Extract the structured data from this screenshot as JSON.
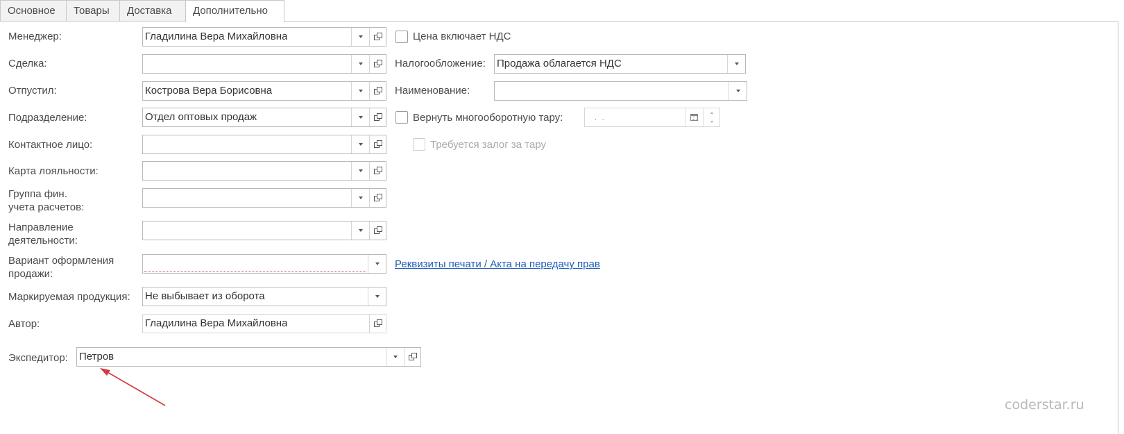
{
  "tabs": [
    {
      "label": "Основное"
    },
    {
      "label": "Товары"
    },
    {
      "label": "Доставка"
    },
    {
      "label": "Дополнительно"
    }
  ],
  "left": {
    "manager": {
      "label": "Менеджер:",
      "value": "Гладилина Вера Михайловна"
    },
    "deal": {
      "label": "Сделка:",
      "value": ""
    },
    "released": {
      "label": "Отпустил:",
      "value": "Кострова Вера Борисовна"
    },
    "division": {
      "label": "Подразделение:",
      "value": "Отдел оптовых продаж"
    },
    "contact": {
      "label": "Контактное лицо:",
      "value": ""
    },
    "loyalty": {
      "label": "Карта лояльности:",
      "value": ""
    },
    "fin_group": {
      "label_1": "Группа фин.",
      "label_2": "учета расчетов:",
      "value": ""
    },
    "direction": {
      "label_1": "Направление",
      "label_2": "деятельности:",
      "value": ""
    },
    "sale_variant": {
      "label_1": "Вариант оформления",
      "label_2": "продажи:",
      "value": ""
    },
    "marked": {
      "label": "Маркируемая продукция:",
      "value": "Не выбывает из оборота"
    },
    "author": {
      "label": "Автор:",
      "value": "Гладилина Вера Михайловна"
    },
    "expeditor": {
      "label": "Экспедитор:",
      "value": "Петров"
    }
  },
  "right": {
    "price_vat": {
      "label": "Цена включает НДС",
      "checked": false
    },
    "taxation": {
      "label": "Налогообложение:",
      "value": "Продажа облагается НДС"
    },
    "name": {
      "label": "Наименование:",
      "value": ""
    },
    "return_tare": {
      "label": "Вернуть многооборотную тару:",
      "checked": false,
      "date_value": " .  ."
    },
    "deposit": {
      "label": "Требуется залог за тару",
      "checked": false
    },
    "print_link": "Реквизиты печати / Акта на передачу прав"
  },
  "watermark": "coderstar.ru",
  "icons": {
    "dropdown": "chevron-down-icon",
    "open": "open-form-icon",
    "calendar": "calendar-icon"
  },
  "colors": {
    "link": "#1c5bb6",
    "arrow": "#d43a3a",
    "border": "#b9b9b9"
  }
}
